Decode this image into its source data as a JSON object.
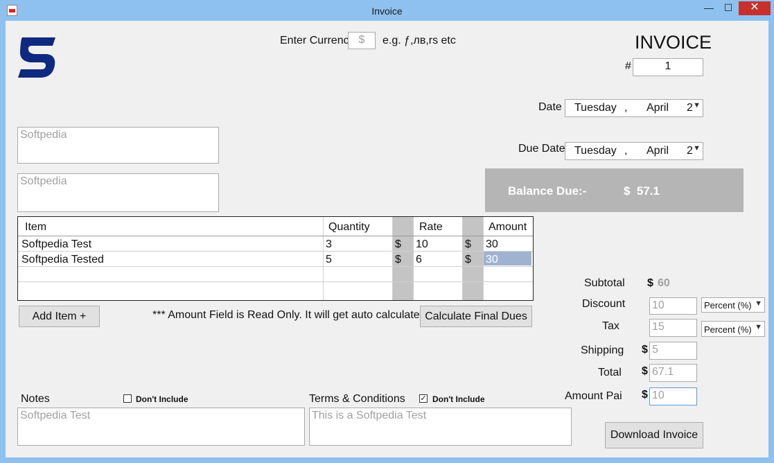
{
  "window": {
    "title": "Invoice",
    "min": "—",
    "max": "☐",
    "close": "✕"
  },
  "currency": {
    "label": "Enter Currenc",
    "placeholder": "$",
    "hint": "e.g. ƒ,лв,rs etc"
  },
  "invoice": {
    "heading": "INVOICE",
    "hash": "#",
    "number": "1"
  },
  "date": {
    "label": "Date",
    "day": "Tuesday",
    "sep": ",",
    "month": "April",
    "digit": "2"
  },
  "due_date": {
    "label": "Due Date",
    "day": "Tuesday",
    "sep": ",",
    "month": "April",
    "digit": "2"
  },
  "from_box": {
    "text": "Softpedia"
  },
  "to_box": {
    "text": "Softpedia"
  },
  "balance": {
    "label": "Balance Due:-",
    "value": "$  57.1"
  },
  "table": {
    "headers": [
      "Item",
      "Quantity",
      "Rate",
      "Amount"
    ],
    "rows": [
      {
        "item": "Softpedia Test",
        "qty": "3",
        "rate_cur": "$",
        "rate": "10",
        "amt_cur": "$",
        "amount": "30"
      },
      {
        "item": "Softpedia Tested",
        "qty": "5",
        "rate_cur": "$",
        "rate": "6",
        "amt_cur": "$",
        "amount": "30"
      }
    ]
  },
  "buttons": {
    "add_item": "Add Item +",
    "calculate": "Calculate Final Dues",
    "download": "Download Invoice"
  },
  "note_readonly": "*** Amount Field is Read Only. It will get auto calculated.",
  "totals": {
    "subtotal_label": "Subtotal",
    "subtotal_cur": "$",
    "subtotal": "60",
    "discount_label": "Discount",
    "discount": "10",
    "discount_mode": "Percent (%)",
    "tax_label": "Tax",
    "tax": "15",
    "tax_mode": "Percent (%)",
    "shipping_label": "Shipping",
    "shipping_cur": "$",
    "shipping": "5",
    "total_label": "Total",
    "total_cur": "$",
    "total": "67.1",
    "paid_label": "Amount Pai",
    "paid_cur": "$",
    "paid": "10"
  },
  "notes": {
    "label": "Notes",
    "dont_include": "Don't Include",
    "text": "Softpedia Test"
  },
  "terms": {
    "label": "Terms & Conditions",
    "dont_include": "Don't Include",
    "checked": "✓",
    "text": "This is a Softpedia Test"
  },
  "colors": {
    "balance_bg": "#b5b5b5",
    "logo": "#0e2a80",
    "selection": "#9fb3d1"
  }
}
